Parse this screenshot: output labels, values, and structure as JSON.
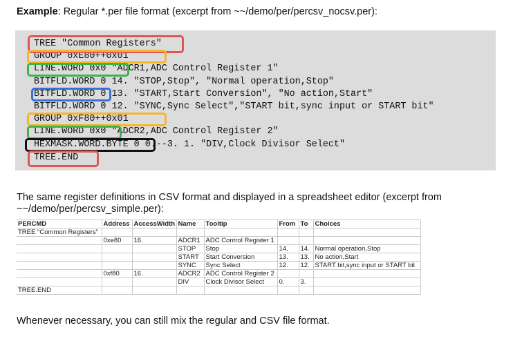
{
  "intro": {
    "label": "Example",
    "text": ": Regular *.per file format (excerpt from ~~/demo/per/percsv_nocsv.per):"
  },
  "code_lines": [
    "TREE \"Common Registers\"",
    "GROUP 0xE80++0x01",
    "LINE.WORD 0x0 \"ADCR1,ADC Control Register 1\"",
    "BITFLD.WORD 0 14. \"STOP,Stop\", \"Normal operation,Stop\"",
    "BITFLD.WORD 0 13. \"START,Start Conversion\", \"No action,Start\"",
    "BITFLD.WORD 0 12. \"SYNC,Sync Select\",\"START bit,sync input or START bit\"",
    "GROUP 0xF80++0x01",
    "LINE.WORD 0x0 \"ADCR2,ADC Control Register 2\"",
    "HEXMASK.WORD.BYTE 0 0.--3. 1. \"DIV,Clock Divisor Select\"",
    "TREE.END"
  ],
  "highlight_colors": {
    "red": "#e05555",
    "orange": "#f5b52a",
    "green": "#3db34a",
    "blue": "#3a6fd8",
    "black": "#111111"
  },
  "paragraph2": "The same register definitions in CSV format and displayed in a spreadsheet editor (excerpt from ~~/demo/per/percsv_simple.per):",
  "sheet": {
    "headers": [
      "PERCMD",
      "Address",
      "AccessWidth",
      "Name",
      "Tooltip",
      "From",
      "To",
      "Choices"
    ],
    "rows": [
      [
        "TREE \"Common Registers\"",
        "",
        "",
        "",
        "",
        "",
        "",
        ""
      ],
      [
        "",
        "0xe80",
        "16.",
        "ADCR1",
        "ADC Control Register 1",
        "",
        "",
        ""
      ],
      [
        "",
        "",
        "",
        "STOP",
        "Stop",
        "14.",
        "14.",
        "Normal operation,Stop"
      ],
      [
        "",
        "",
        "",
        "START",
        "Start Conversion",
        "13.",
        "13.",
        "No action,Start"
      ],
      [
        "",
        "",
        "",
        "SYNC",
        "Sync Select",
        "12.",
        "12.",
        "START bit,sync input or START bit"
      ],
      [
        "",
        "0xf80",
        "16.",
        "ADCR2",
        "ADC Control Register 2",
        "",
        "",
        ""
      ],
      [
        "",
        "",
        "",
        "DIV",
        "Clock Divisor Select",
        "0.",
        "3.",
        ""
      ],
      [
        "TREE.END",
        "",
        "",
        "",
        "",
        "",
        "",
        ""
      ]
    ]
  },
  "paragraph3": "Whenever necessary, you can still mix the regular and CSV file format."
}
